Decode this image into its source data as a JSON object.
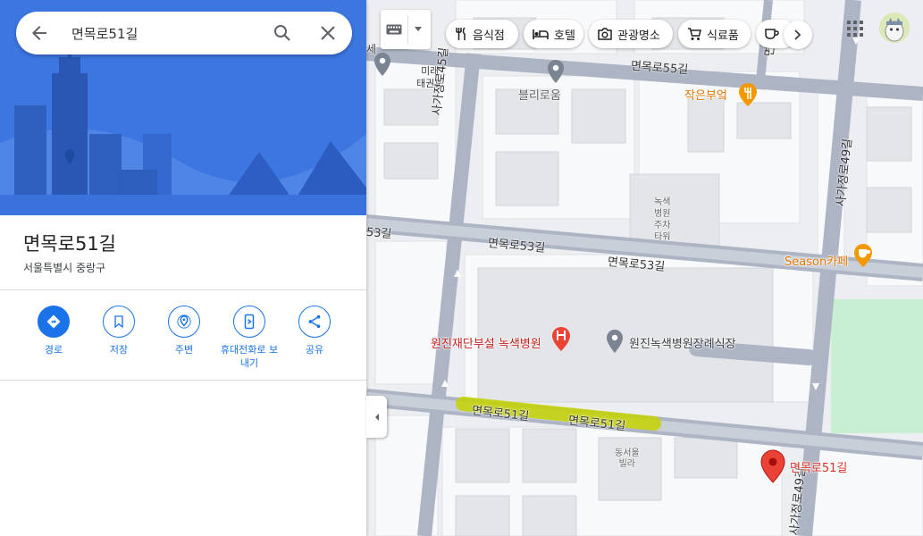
{
  "search": {
    "value": "면목로51길",
    "back_label": "뒤로",
    "search_label": "검색",
    "clear_label": "지우기"
  },
  "place": {
    "title": "면목로51길",
    "subtitle": "서울특별시 중랑구"
  },
  "actions": [
    {
      "label": "경로",
      "icon": "directions-icon"
    },
    {
      "label": "저장",
      "icon": "bookmark-icon"
    },
    {
      "label": "주변",
      "icon": "nearby-icon"
    },
    {
      "label": "휴대전화로 보내기",
      "icon": "send-to-phone-icon"
    },
    {
      "label": "공유",
      "icon": "share-icon"
    }
  ],
  "chips": [
    {
      "label": "음식점",
      "icon": "restaurant-icon"
    },
    {
      "label": "호텔",
      "icon": "hotel-icon"
    },
    {
      "label": "관광명소",
      "icon": "camera-icon"
    },
    {
      "label": "식료품",
      "icon": "cart-icon"
    },
    {
      "label": "커피",
      "icon": "coffee-icon"
    }
  ],
  "map_labels": {
    "miraetaekwondo": "미래\n태권도",
    "bullirowoom": "블리로움",
    "jakeunbueok": "작은부엌",
    "road_55": "면목로55길",
    "road_53_left": "면목로53길",
    "road_53_right": "면목로53길",
    "road_53_edge": "53길",
    "road_51_a": "면목로51길",
    "road_51_b": "면목로51길",
    "sagajeong45": "사가정로45길",
    "sagajeong49_top": "사가정로49길",
    "sagajeong49_bottom": "사가정로49길",
    "green_parking": "녹색\n병원\n주차\n타워",
    "season_cafe": "Season카페",
    "green_hospital": "원진재단부설 녹색병원",
    "funeral_hall": "원진녹색병원장례식장",
    "dongseo_villa": "동서울\n빌라",
    "pin_label": "면목로51길",
    "edge_top": "면",
    "edge_left": "세"
  },
  "colors": {
    "accent": "#1a73e8",
    "pin": "#ea4335",
    "poi_orange": "#f29900",
    "road": "#adb5c5",
    "highlight": "#c6d300",
    "park": "#c8efd2"
  }
}
